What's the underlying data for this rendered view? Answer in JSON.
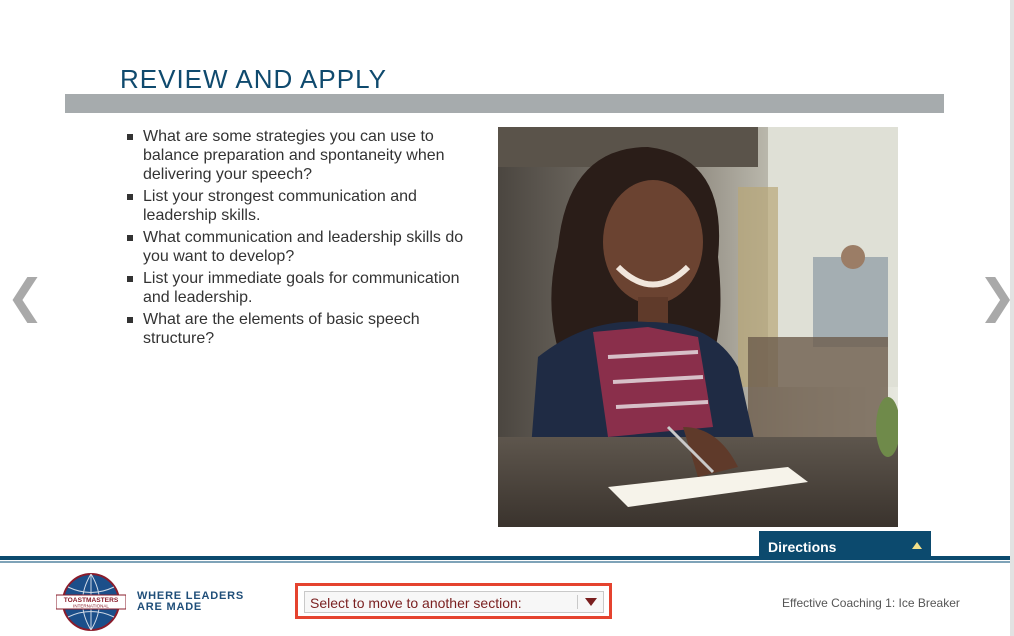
{
  "slide": {
    "title": "REVIEW AND APPLY",
    "bullets": [
      "What are some strategies you can use to balance preparation and spontaneity when delivering your speech?",
      "List your strongest communication and leadership skills.",
      "What communication and leadership skills do you want to develop?",
      "List your immediate goals for communication and leadership.",
      "What are the elements of basic speech structure?"
    ]
  },
  "nav": {
    "prev_icon": "❮",
    "next_icon": "❯"
  },
  "directions": {
    "label": "Directions"
  },
  "footer": {
    "logo_text_top": "TOASTMASTERS",
    "logo_text_bottom": "INTERNATIONAL",
    "tagline_line1": "WHERE LEADERS",
    "tagline_line2": "ARE MADE",
    "section_select": {
      "label": "Select to move to another section:"
    },
    "course_name": "Effective Coaching 1: Ice Breaker"
  },
  "colors": {
    "title": "#0f4a6e",
    "title_bar": "#a6abad",
    "footer_line": "#0c4a6e",
    "directions_bg": "#0c4a6e",
    "select_border": "#e5432f",
    "select_text": "#7a1f1f"
  },
  "icons": {
    "prev": "chevron-left-icon",
    "next": "chevron-right-icon",
    "directions_toggle": "triangle-up-icon",
    "select_dropdown": "triangle-down-icon"
  }
}
